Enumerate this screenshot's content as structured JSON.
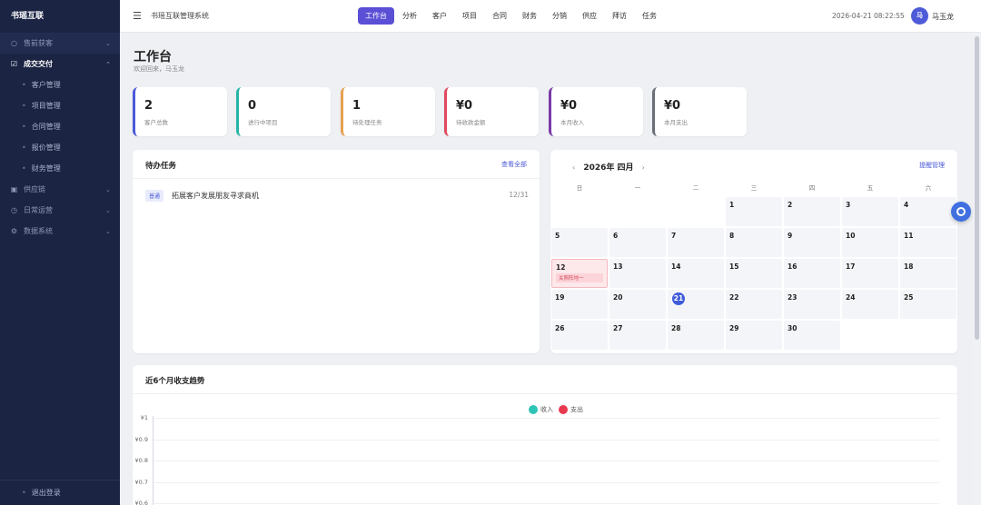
{
  "sidebar": {
    "brand": "书瑶互联",
    "groups": [
      {
        "label": "售前获客",
        "icon": "search-icon"
      },
      {
        "label": "成交交付",
        "icon": "check-square-icon"
      },
      {
        "label": "供应链",
        "icon": "box-icon"
      },
      {
        "label": "日常运营",
        "icon": "clock-icon"
      },
      {
        "label": "数据系统",
        "icon": "gear-icon"
      }
    ],
    "sub_items": [
      "客户管理",
      "项目管理",
      "合同管理",
      "报价管理",
      "财务管理"
    ],
    "logout": "退出登录"
  },
  "topbar": {
    "system_title": "书瑶互联管理系统",
    "nav": [
      "工作台",
      "分析",
      "客户",
      "项目",
      "合同",
      "财务",
      "分销",
      "供应",
      "拜访",
      "任务"
    ],
    "active_nav": "工作台",
    "datetime": "2026-04-21 08:22:55",
    "avatar_initial": "马",
    "username": "马玉龙"
  },
  "page": {
    "title": "工作台",
    "subtitle": "欢迎回来，马玉龙"
  },
  "stats": [
    {
      "value": "2",
      "label": "客户总数",
      "color": "#4a5ad8"
    },
    {
      "value": "0",
      "label": "进行中项目",
      "color": "#26b5a6"
    },
    {
      "value": "1",
      "label": "待处理任务",
      "color": "#e8a04f"
    },
    {
      "value": "¥0",
      "label": "待收款金额",
      "color": "#e04a5c"
    },
    {
      "value": "¥0",
      "label": "本月收入",
      "color": "#7a3aa8"
    },
    {
      "value": "¥0",
      "label": "本月支出",
      "color": "#6b6f78"
    }
  ],
  "tasks": {
    "title": "待办任务",
    "view_all": "查看全部",
    "items": [
      {
        "tag": "普通",
        "name": "拓展客户发展朋友寻求商机",
        "date": "12/31"
      }
    ]
  },
  "calendar": {
    "title": "2026年 四月",
    "prev": "‹",
    "next": "›",
    "manage_link": "提醒管理",
    "weekdays": [
      "日",
      "一",
      "二",
      "三",
      "四",
      "五",
      "六"
    ],
    "days": [
      "1",
      "2",
      "3",
      "4",
      "5",
      "6",
      "7",
      "8",
      "9",
      "10",
      "11",
      "12",
      "13",
      "14",
      "15",
      "16",
      "17",
      "18",
      "19",
      "20",
      "21",
      "22",
      "23",
      "24",
      "25",
      "26",
      "27",
      "28",
      "29",
      "30"
    ],
    "first_weekday": 3,
    "today": "21",
    "event_day": "12",
    "event_label": "关照阵地一"
  },
  "trend": {
    "title": "近6个月收支趋势",
    "legend": [
      {
        "name": "收入",
        "color": "#2ec4b6"
      },
      {
        "name": "支出",
        "color": "#e8394f"
      }
    ],
    "y_ticks": [
      "¥1",
      "¥0.9",
      "¥0.8",
      "¥0.7",
      "¥0.6"
    ]
  },
  "chart_data": {
    "type": "line",
    "title": "近6个月收支趋势",
    "series": [
      {
        "name": "收入",
        "values": []
      },
      {
        "name": "支出",
        "values": []
      }
    ],
    "y_tick_labels": [
      "¥1",
      "¥0.9",
      "¥0.8",
      "¥0.7",
      "¥0.6"
    ],
    "ylim": [
      0.6,
      1
    ],
    "grid": true,
    "legend_position": "top-center"
  }
}
